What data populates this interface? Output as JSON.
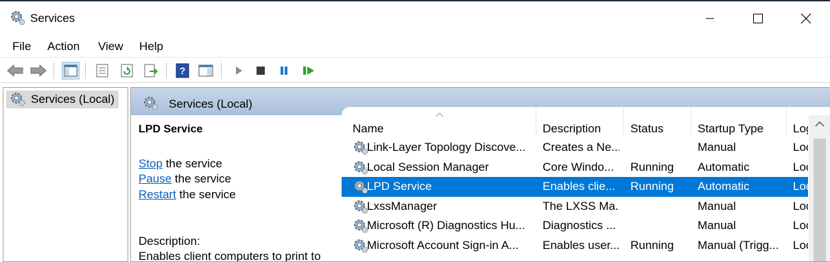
{
  "window": {
    "title": "Services"
  },
  "menu": [
    "File",
    "Action",
    "View",
    "Help"
  ],
  "toolbar_icons": [
    "back-arrow-icon",
    "forward-arrow-icon",
    "console-tree-icon",
    "properties-icon",
    "refresh-icon",
    "export-list-icon",
    "help-icon",
    "show-hide-action-pane-icon",
    "start-service-icon",
    "stop-service-icon",
    "pause-service-icon",
    "restart-service-icon"
  ],
  "tree": {
    "node_label": "Services (Local)"
  },
  "main": {
    "header_title": "Services (Local)",
    "detail": {
      "service_name": "LPD Service",
      "actions": [
        {
          "link": "Stop",
          "rest": " the service"
        },
        {
          "link": "Pause",
          "rest": " the service"
        },
        {
          "link": "Restart",
          "rest": " the service"
        }
      ],
      "description_label": "Description:",
      "description_text": "Enables client computers to print to"
    },
    "columns": [
      "Name",
      "Description",
      "Status",
      "Startup Type",
      "Log"
    ],
    "rows": [
      {
        "name": "Link-Layer Topology Discove...",
        "description": "Creates a Ne...",
        "status": "",
        "startup": "Manual",
        "logon": "Loc",
        "selected": false
      },
      {
        "name": "Local Session Manager",
        "description": "Core Windo...",
        "status": "Running",
        "startup": "Automatic",
        "logon": "Loc",
        "selected": false
      },
      {
        "name": "LPD Service",
        "description": "Enables clie...",
        "status": "Running",
        "startup": "Automatic",
        "logon": "Loc",
        "selected": true
      },
      {
        "name": "LxssManager",
        "description": "The LXSS Ma...",
        "status": "",
        "startup": "Manual",
        "logon": "Loc",
        "selected": false
      },
      {
        "name": "Microsoft (R) Diagnostics Hu...",
        "description": "Diagnostics ...",
        "status": "",
        "startup": "Manual",
        "logon": "Loc",
        "selected": false
      },
      {
        "name": "Microsoft Account Sign-in A...",
        "description": "Enables user...",
        "status": "Running",
        "startup": "Manual (Trigg...",
        "logon": "Loc",
        "selected": false
      }
    ]
  },
  "colors": {
    "selection": "#0078d7",
    "link": "#0a5fc2",
    "header_band": "#b4c8e1"
  }
}
